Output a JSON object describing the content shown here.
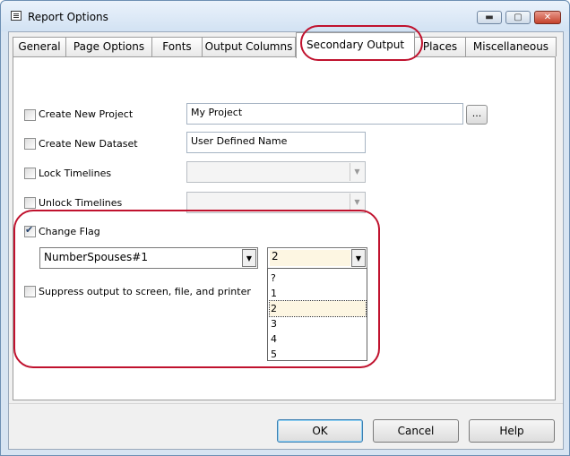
{
  "window": {
    "title": "Report Options",
    "minimize_glyph": "▬",
    "maximize_glyph": "▢",
    "close_glyph": "✕"
  },
  "tabs": [
    {
      "label": "General"
    },
    {
      "label": "Page Options"
    },
    {
      "label": "Fonts"
    },
    {
      "label": "Output Columns"
    },
    {
      "label": "Secondary Output",
      "active": true
    },
    {
      "label": "Places"
    },
    {
      "label": "Miscellaneous"
    }
  ],
  "form": {
    "create_new_project": {
      "label": "Create New Project",
      "checked": false,
      "value": "My Project",
      "browse_label": "..."
    },
    "create_new_dataset": {
      "label": "Create New Dataset",
      "checked": false,
      "value": "User Defined Name"
    },
    "lock_timelines": {
      "label": "Lock Timelines",
      "checked": false,
      "value": ""
    },
    "unlock_timelines": {
      "label": "Unlock Timelines",
      "checked": false,
      "value": ""
    },
    "change_flag": {
      "label": "Change Flag",
      "checked": true,
      "field": "NumberSpouses#1",
      "value": "2"
    },
    "suppress_output": {
      "label": "Suppress output to screen, file, and printer",
      "checked": false
    }
  },
  "dropdown": {
    "options": [
      "?",
      "1",
      "2",
      "3",
      "4",
      "5"
    ],
    "selected": "2"
  },
  "buttons": {
    "ok": "OK",
    "cancel": "Cancel",
    "help": "Help"
  },
  "icons": {
    "app": "report-icon",
    "dropdown": "chevron-down-icon"
  },
  "colors": {
    "annotation": "#c0122e",
    "titlebar": "#d7e4f2",
    "selection": "#fdf6e2"
  }
}
